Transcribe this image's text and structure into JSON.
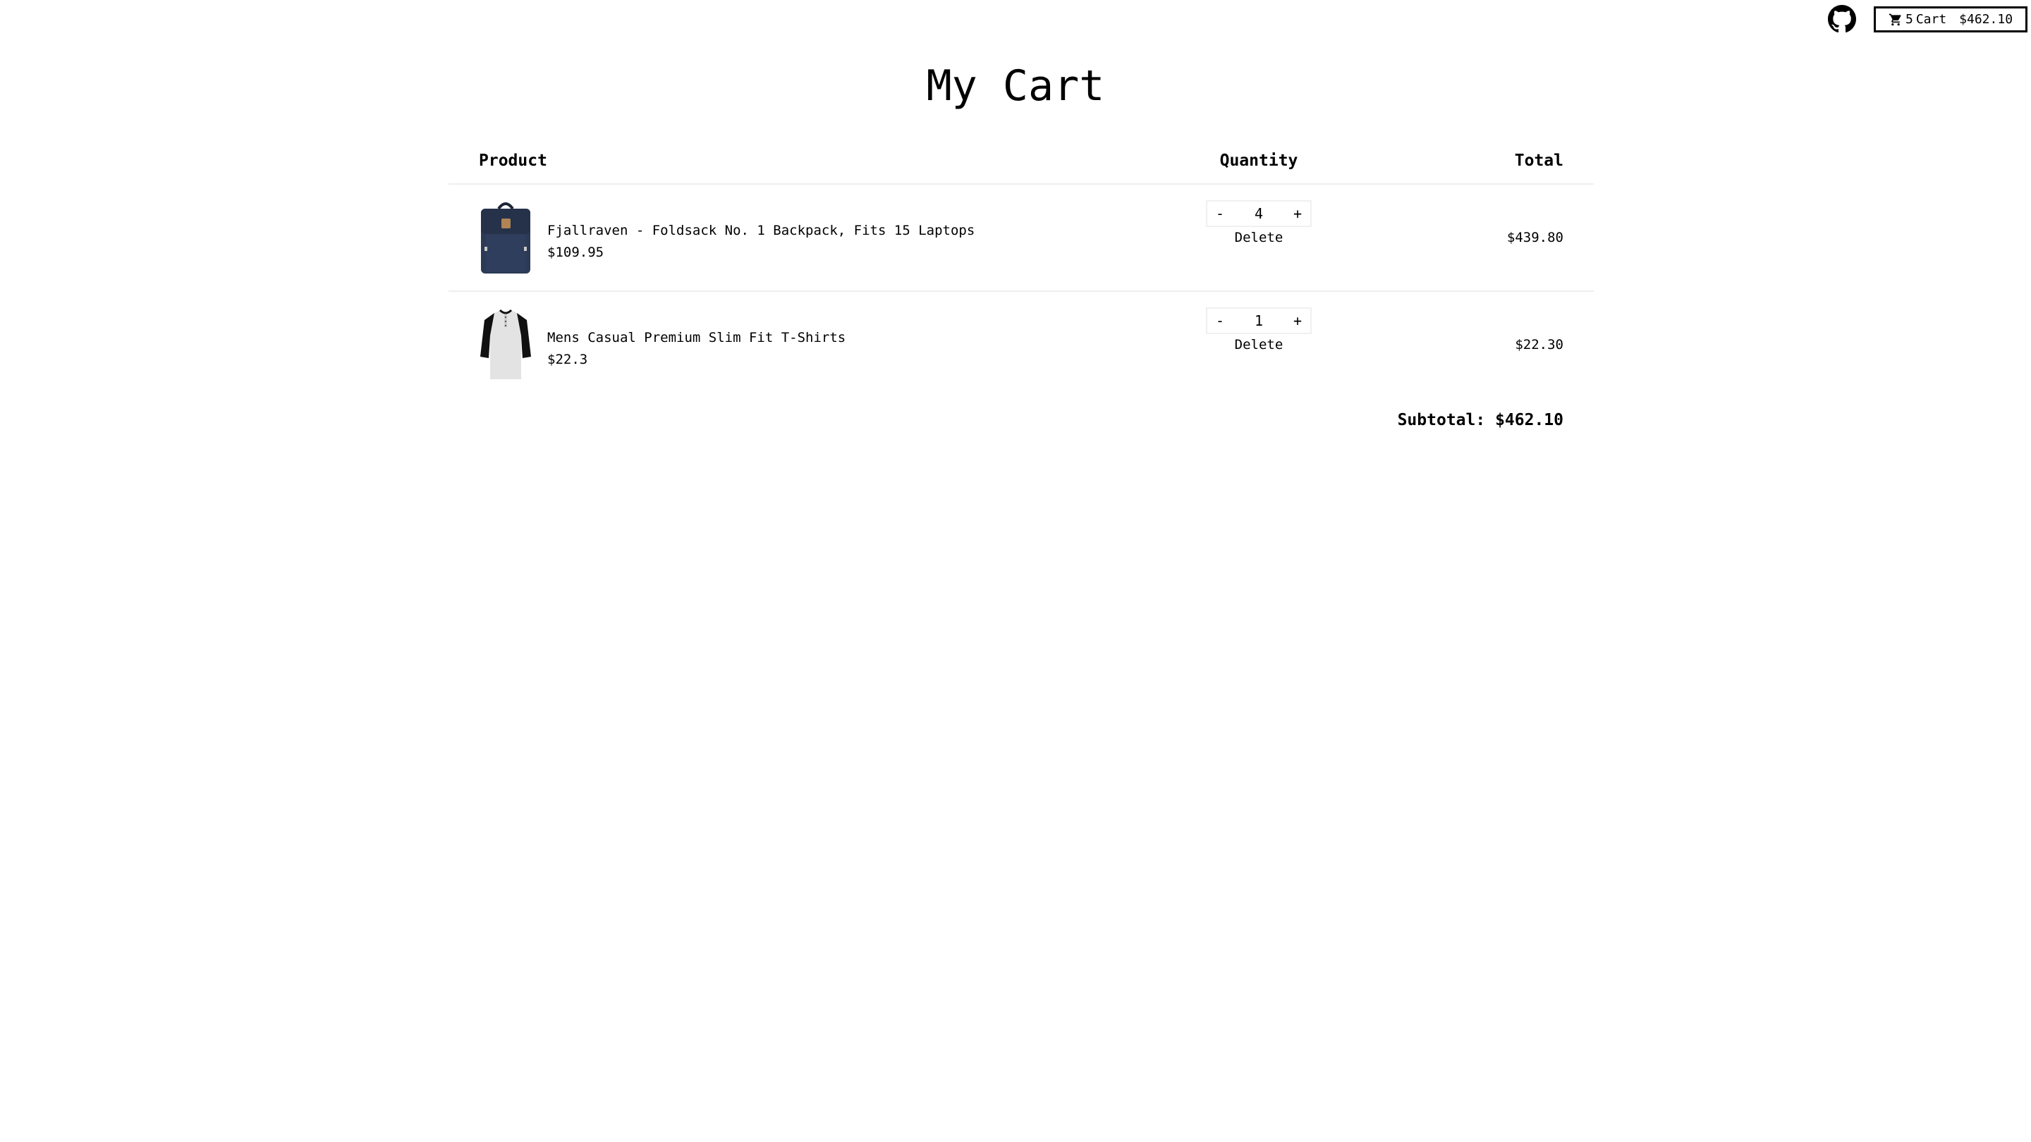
{
  "header": {
    "cart_count": "5",
    "cart_label": "Cart",
    "cart_total": "$462.10"
  },
  "page": {
    "title": "My Cart"
  },
  "table": {
    "headers": {
      "product": "Product",
      "quantity": "Quantity",
      "total": "Total"
    },
    "rows": [
      {
        "name": "Fjallraven - Foldsack No. 1 Backpack, Fits 15 Laptops",
        "price": "$109.95",
        "quantity": "4",
        "decrement": "-",
        "increment": "+",
        "delete_label": "Delete",
        "total": "$439.80"
      },
      {
        "name": "Mens Casual Premium Slim Fit T-Shirts",
        "price": "$22.3",
        "quantity": "1",
        "decrement": "-",
        "increment": "+",
        "delete_label": "Delete",
        "total": "$22.30"
      }
    ]
  },
  "summary": {
    "subtotal_label": "Subtotal:",
    "subtotal_value": "$462.10"
  },
  "icons": {
    "github": "github-icon",
    "cart": "shopping-cart-icon",
    "backpack": "backpack-product-image",
    "tshirt": "tshirt-product-image"
  }
}
